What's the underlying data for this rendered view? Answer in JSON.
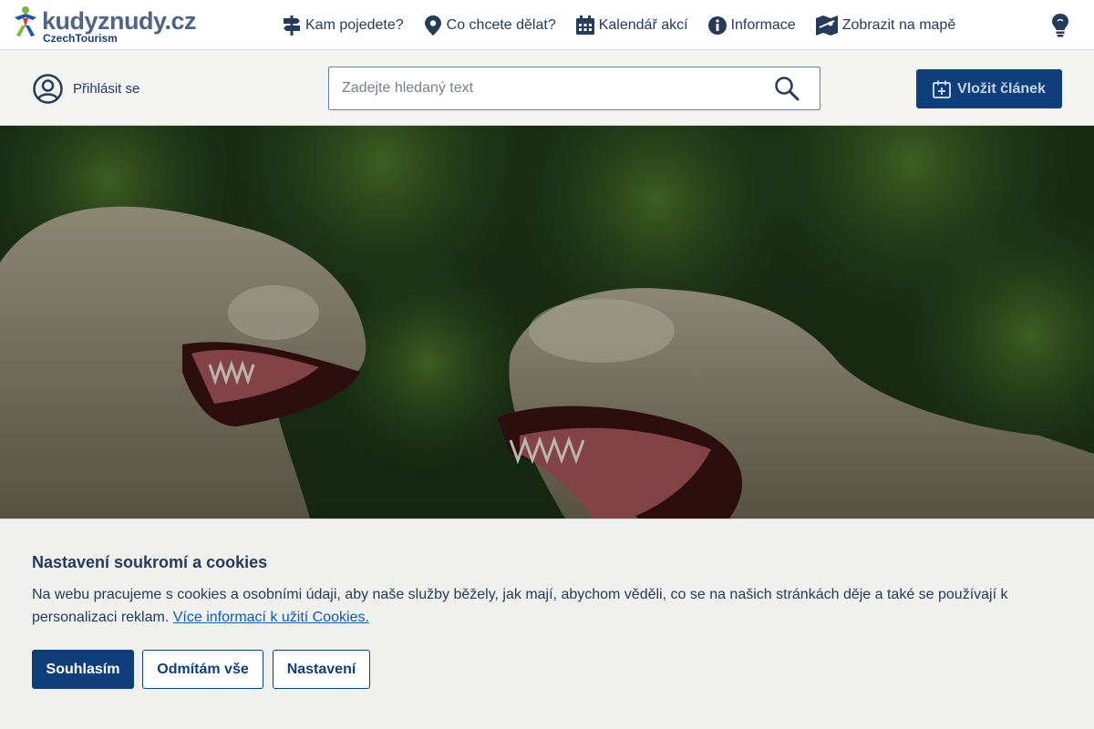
{
  "brand": {
    "name": "kudyznudy.cz",
    "subtitle": "CzechTourism",
    "colors": {
      "green": "#7ab73a",
      "red": "#e03a2f",
      "blue": "#1a5aa8",
      "navy": "#0f3f7a"
    }
  },
  "nav": {
    "items": [
      {
        "label": "Kam pojedete?",
        "icon": "signpost-icon"
      },
      {
        "label": "Co chcete dělat?",
        "icon": "map-pin-icon"
      },
      {
        "label": "Kalendář akcí",
        "icon": "calendar-icon"
      },
      {
        "label": "Informace",
        "icon": "info-icon"
      },
      {
        "label": "Zobrazit na mapě",
        "icon": "map-icon"
      }
    ],
    "tip_icon": "lightbulb-icon"
  },
  "account": {
    "login_label": "Přihlásit se",
    "icon": "user-circle-icon"
  },
  "search": {
    "placeholder": "Zadejte hledaný text",
    "value": "",
    "icon": "search-icon"
  },
  "cta": {
    "label": "Vložit článek",
    "icon": "calendar-plus-icon"
  },
  "hero": {
    "image": "dinosaur-statues-photo"
  },
  "cookie": {
    "title": "Nastavení soukromí a cookies",
    "text": "Na webu pracujeme s cookies a osobními údaji, aby naše služby běžely, jak mají, abychom věděli, co se na našich stránkách děje a také se používají k personalizaci reklam.",
    "link": "Více informací k užití Cookies.",
    "accept_label": "Souhlasím",
    "reject_label": "Odmítám vše",
    "settings_label": "Nastavení"
  }
}
